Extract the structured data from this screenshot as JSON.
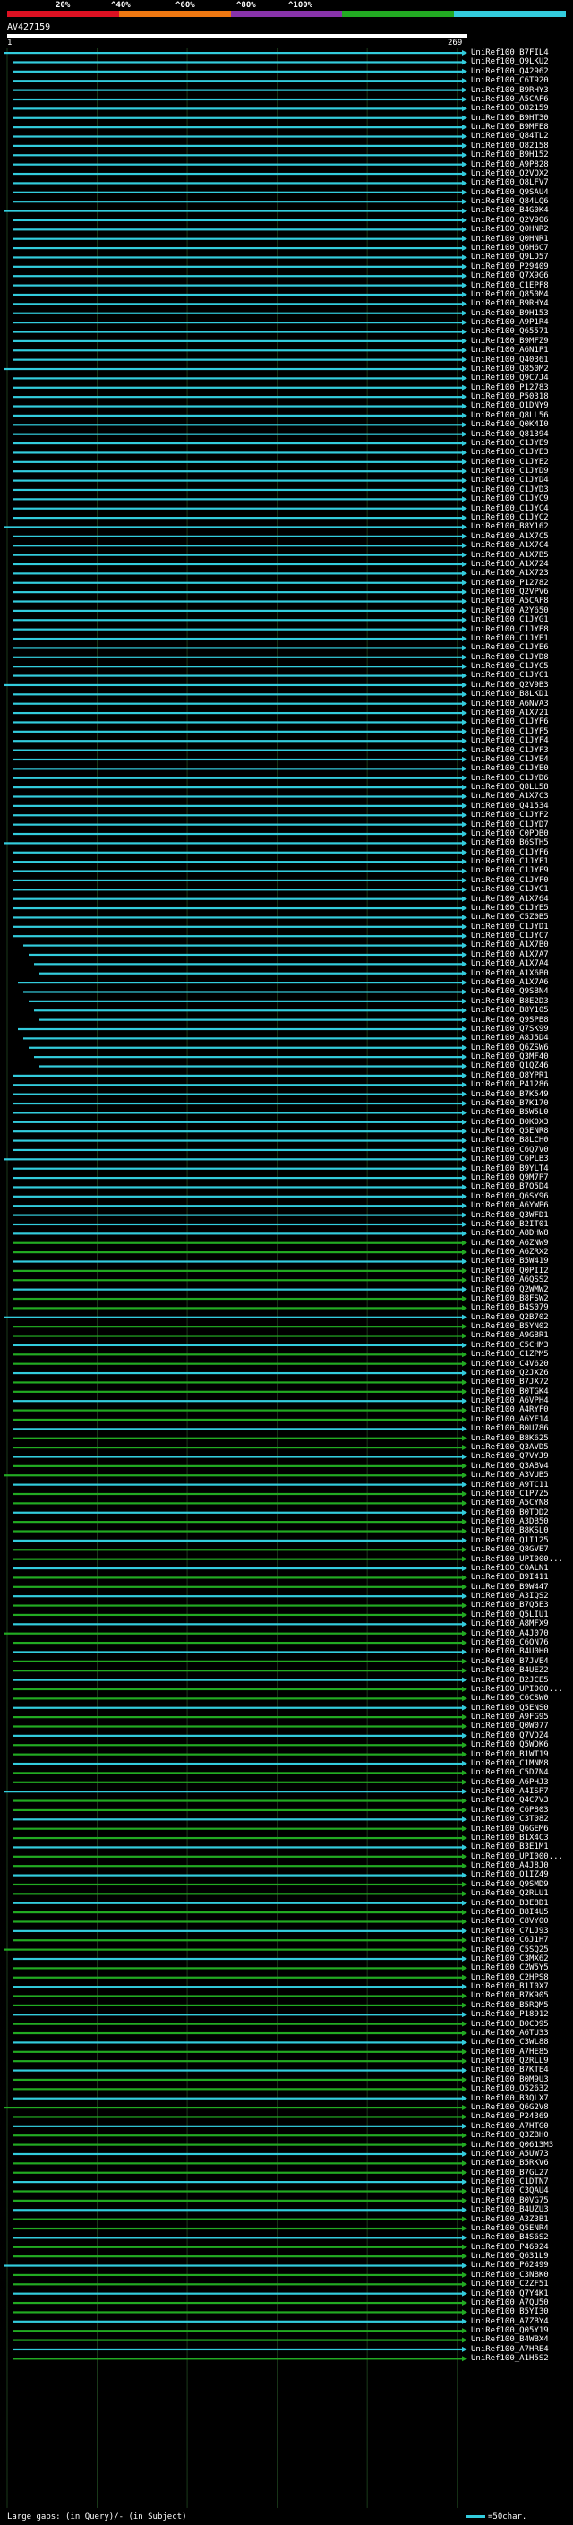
{
  "legend": {
    "labels": [
      "20%",
      "^40%",
      "^60%",
      "^80%",
      "^100%"
    ],
    "colors": [
      "#dd1122",
      "#ee7711",
      "#8833aa",
      "#22aa22",
      "#33ccdd"
    ]
  },
  "query": {
    "name": "AV427159",
    "start": "1",
    "end": "269"
  },
  "footer": {
    "text": "Large gaps: (in Query)/- (in Subject)",
    "scale": "=50char."
  },
  "hits": [
    "UniRef100_B7FIL4",
    "UniRef100_Q9LKU2",
    "UniRef100_Q42962",
    "UniRef100_C6T920",
    "UniRef100_B9RHY3",
    "UniRef100_A5CAF6",
    "UniRef100_O82159",
    "UniRef100_B9HT30",
    "UniRef100_B9MFE8",
    "UniRef100_Q84TL2",
    "UniRef100_O82158",
    "UniRef100_B9H152",
    "UniRef100_A9P828",
    "UniRef100_Q2VOX2",
    "UniRef100_Q8LFV7",
    "UniRef100_Q9SAU4",
    "UniRef100_Q84LQ6",
    "UniRef100_B4G0K4",
    "UniRef100_Q2V9O6",
    "UniRef100_Q0HNR2",
    "UniRef100_Q0HNR1",
    "UniRef100_Q6H6C7",
    "UniRef100_Q9LD57",
    "UniRef100_P29409",
    "UniRef100_Q7X9G6",
    "UniRef100_C1EPF8",
    "UniRef100_Q850M4",
    "UniRef100_B9RHY4",
    "UniRef100_B9H153",
    "UniRef100_A9P1R4",
    "UniRef100_Q65571",
    "UniRef100_B9MFZ9",
    "UniRef100_A6N1P1",
    "UniRef100_Q40361",
    "UniRef100_Q850M2",
    "UniRef100_Q9C7J4",
    "UniRef100_P12783",
    "UniRef100_P50318",
    "UniRef100_Q1DNY9",
    "UniRef100_Q8LL56",
    "UniRef100_Q0K4I0",
    "UniRef100_Q81394",
    "UniRef100_C1JYE9",
    "UniRef100_C1JYE3",
    "UniRef100_C1JYE2",
    "UniRef100_C1JYD9",
    "UniRef100_C1JYD4",
    "UniRef100_C1JYD3",
    "UniRef100_C1JYC9",
    "UniRef100_C1JYC4",
    "UniRef100_C1JYC2",
    "UniRef100_B8Y162",
    "UniRef100_A1X7C5",
    "UniRef100_A1X7C4",
    "UniRef100_A1X7B5",
    "UniRef100_A1X724",
    "UniRef100_A1X723",
    "UniRef100_P12782",
    "UniRef100_Q2VPV6",
    "UniRef100_A5CAF8",
    "UniRef100_A2Y650",
    "UniRef100_C1JYG1",
    "UniRef100_C1JYE8",
    "UniRef100_C1JYE1",
    "UniRef100_C1JYE6",
    "UniRef100_C1JYD8",
    "UniRef100_C1JYC5",
    "UniRef100_C1JYC1",
    "UniRef100_Q2V9B3",
    "UniRef100_B8LKD1",
    "UniRef100_A6NVA3",
    "UniRef100_A1X721",
    "UniRef100_C1JYF6",
    "UniRef100_C1JYF5",
    "UniRef100_C1JYF4",
    "UniRef100_C1JYF3",
    "UniRef100_C1JYE4",
    "UniRef100_C1JYE0",
    "UniRef100_C1JYD6",
    "UniRef100_Q8LL58",
    "UniRef100_A1X7C3",
    "UniRef100_Q41534",
    "UniRef100_C1JYF2",
    "UniRef100_C1JYD7",
    "UniRef100_C0PDB0",
    "UniRef100_B6STH5",
    "UniRef100_C1JYF6",
    "UniRef100_C1JYF1",
    "UniRef100_C1JYF9",
    "UniRef100_C1JYF0",
    "UniRef100_C1JYC1",
    "UniRef100_A1X764",
    "UniRef100_C1JYE5",
    "UniRef100_C5Z0B5",
    "UniRef100_C1JYD1",
    "UniRef100_C1JYC7",
    "UniRef100_A1X7B0",
    "UniRef100_A1X7A7",
    "UniRef100_A1X7A4",
    "UniRef100_A1X6B0",
    "UniRef100_A1X7A6",
    "UniRef100_Q9SBN4",
    "UniRef100_B8E2D3",
    "UniRef100_B8Y105",
    "UniRef100_Q9SPB8",
    "UniRef100_Q7SK99",
    "UniRef100_A8J5D4",
    "UniRef100_Q6ZSW6",
    "UniRef100_Q3MF40",
    "UniRef100_Q1QZ46",
    "UniRef100_Q8YPR1",
    "UniRef100_P41286",
    "UniRef100_B7K549",
    "UniRef100_B7K170",
    "UniRef100_B5W5L0",
    "UniRef100_B0K0X3",
    "UniRef100_Q5ENR8",
    "UniRef100_B8LCH0",
    "UniRef100_C6Q7V0",
    "UniRef100_C6PLB3",
    "UniRef100_B9YLT4",
    "UniRef100_Q9M7P7",
    "UniRef100_B7Q5D4",
    "UniRef100_Q6SY96",
    "UniRef100_A6YWP6",
    "UniRef100_Q3WFD1",
    "UniRef100_B2IT01",
    "UniRef100_A8DHW8",
    "UniRef100_A6ZNW9",
    "UniRef100_A6ZRX2",
    "UniRef100_B5W419",
    "UniRef100_Q0PII2",
    "UniRef100_A6QSS2",
    "UniRef100_Q2WMW2",
    "UniRef100_B8FSW2",
    "UniRef100_B4S079",
    "UniRef100_Q2B702",
    "UniRef100_B5YN02",
    "UniRef100_A9GBR1",
    "UniRef100_C5CHM3",
    "UniRef100_C1ZPM5",
    "UniRef100_C4V620",
    "UniRef100_Q2JXZ6",
    "UniRef100_B7JX72",
    "UniRef100_B0TGK4",
    "UniRef100_A6VPH4",
    "UniRef100_A4RYF0",
    "UniRef100_A6YF14",
    "UniRef100_B0U786",
    "UniRef100_B8K625",
    "UniRef100_Q3AVD5",
    "UniRef100_Q7VYJ9",
    "UniRef100_Q3ABV4",
    "UniRef100_A3VUB5",
    "UniRef100_A9TC11",
    "UniRef100_C1P7Z5",
    "UniRef100_A5CYN8",
    "UniRef100_B0TDD2",
    "UniRef100_A3DB50",
    "UniRef100_B8KSL0",
    "UniRef100_Q1I125",
    "UniRef100_Q8GVE7",
    "UniRef100_UPI000...",
    "UniRef100_C0ALN1",
    "UniRef100_B9I411",
    "UniRef100_B9W447",
    "UniRef100_A3IQS2",
    "UniRef100_B7Q5E3",
    "UniRef100_Q5LIU1",
    "UniRef100_A8MFX9",
    "UniRef100_A4J070",
    "UniRef100_C6QN76",
    "UniRef100_B4U0H0",
    "UniRef100_B7JVE4",
    "UniRef100_B4UEZ2",
    "UniRef100_B2JCE5",
    "UniRef100_UPI000...",
    "UniRef100_C6CSW0",
    "UniRef100_Q5ENS0",
    "UniRef100_A9FG95",
    "UniRef100_Q0W077",
    "UniRef100_Q7VDZ4",
    "UniRef100_Q5WDK6",
    "UniRef100_B1WT19",
    "UniRef100_C1MNM8",
    "UniRef100_C5D7N4",
    "UniRef100_A6PHJ3",
    "UniRef100_A4ISP7",
    "UniRef100_Q4C7V3",
    "UniRef100_C6P803",
    "UniRef100_C3T082",
    "UniRef100_Q6GEM6",
    "UniRef100_B1X4C3",
    "UniRef100_B3E1M1",
    "UniRef100_UPI000...",
    "UniRef100_A4J8J0",
    "UniRef100_Q1IZ49",
    "UniRef100_Q9SMD9",
    "UniRef100_Q2RLU1",
    "UniRef100_B3E8D1",
    "UniRef100_B8I4U5",
    "UniRef100_C8VY00",
    "UniRef100_C7LJ93",
    "UniRef100_C6J1H7",
    "UniRef100_C5SQ25",
    "UniRef100_C3MX62",
    "UniRef100_C2W5Y5",
    "UniRef100_C2HPS8",
    "UniRef100_B1I0X7",
    "UniRef100_B7K905",
    "UniRef100_B5RQM5",
    "UniRef100_P18912",
    "UniRef100_B0CD95",
    "UniRef100_A6TU33",
    "UniRef100_C3WL88",
    "UniRef100_A7HE85",
    "UniRef100_Q2RLL9",
    "UniRef100_B7KTE4",
    "UniRef100_B0M9U3",
    "UniRef100_Q52632",
    "UniRef100_B3QLX7",
    "UniRef100_Q6G2V8",
    "UniRef100_P24369",
    "UniRef100_A7HTG0",
    "UniRef100_Q3ZBH0",
    "UniRef100_Q0613M3",
    "UniRef100_A5UW73",
    "UniRef100_B5RKV6",
    "UniRef100_B7GL27",
    "UniRef100_C1DTN7",
    "UniRef100_C3QAU4",
    "UniRef100_B0VG75",
    "UniRef100_B4UZU3",
    "UniRef100_A3Z3B1",
    "UniRef100_Q5ENR4",
    "UniRef100_B4S6S2",
    "UniRef100_P46924",
    "UniRef100_Q631L9",
    "UniRef100_P62499",
    "UniRef100_C3NBK0",
    "UniRef100_C2ZF51",
    "UniRef100_Q7Y4K1",
    "UniRef100_A7QU50",
    "UniRef100_B5YI30",
    "UniRef100_A7ZBY4",
    "UniRef100_Q05Y19",
    "UniRef100_B4WBX4",
    "UniRef100_A7HRE4",
    "UniRef100_A1H5S2"
  ]
}
